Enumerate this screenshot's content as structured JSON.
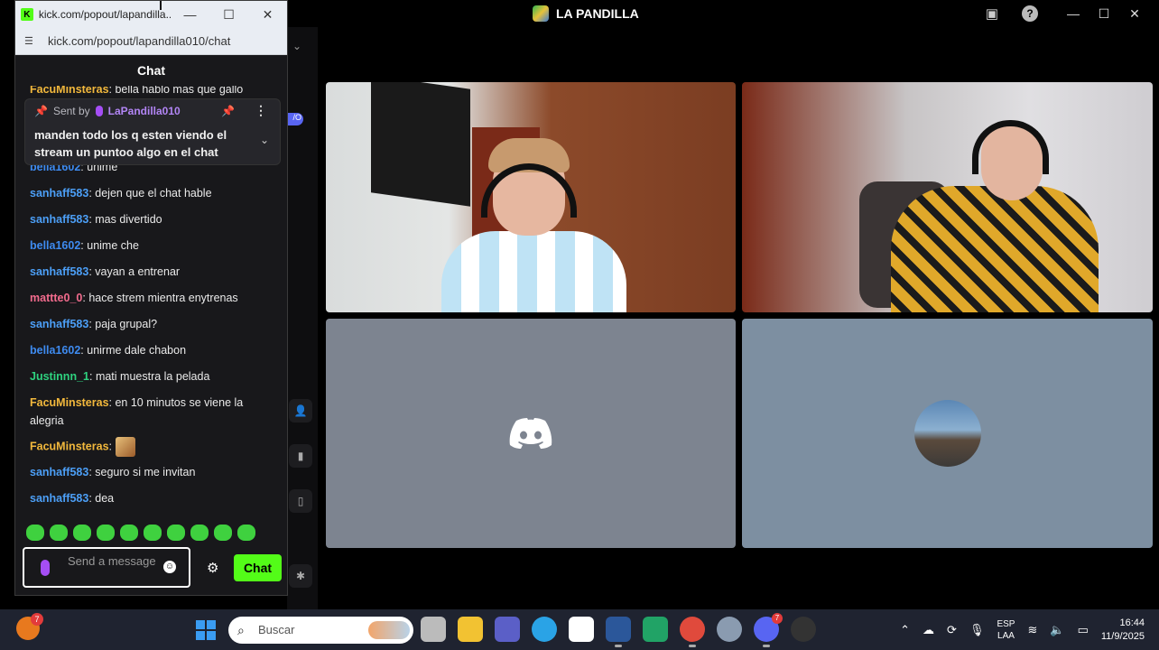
{
  "discord": {
    "server_title": "LA PANDILLA",
    "help_icon": "?",
    "window_controls": [
      "—",
      "☐",
      "✕"
    ],
    "pill_label": "/O"
  },
  "kick": {
    "window_title": "kick.com/popout/lapandilla...",
    "url": "kick.com/popout/lapandilla010/chat",
    "window_controls": [
      "—",
      "☐",
      "✕"
    ],
    "header": "Chat",
    "top_cut_message": {
      "user": "FacuMinsteras",
      "text": ": bella hablo mas que gallo"
    },
    "pinned": {
      "sent_by_label": "Sent by",
      "user": "LaPandilla010",
      "text": "manden todo los q esten viendo el stream un puntoo algo en el chat"
    },
    "messages": [
      {
        "user": "bella1602",
        "text": ": unime"
      },
      {
        "user": "sanhaff583",
        "text": ": dejen que el chat hable"
      },
      {
        "user": "sanhaff583",
        "text": ": mas divertido"
      },
      {
        "user": "bella1602",
        "text": ": unime che"
      },
      {
        "user": "sanhaff583",
        "text": ": vayan a entrenar"
      },
      {
        "user": "mattte0_0",
        "text": ": hace strem mientra enytrenas"
      },
      {
        "user": "sanhaff583",
        "text": ": paja grupal?"
      },
      {
        "user": "bella1602",
        "text": ": unirme dale chabon"
      },
      {
        "user": "Justinnn_1",
        "text": ": mati muestra la pelada"
      },
      {
        "user": "FacuMinsteras",
        "text": ": en 10 minutos se viene la alegria"
      },
      {
        "user": "FacuMinsteras",
        "text": ":"
      },
      {
        "user": "sanhaff583",
        "text": ": seguro si me invitan"
      },
      {
        "user": "sanhaff583",
        "text": ": dea"
      }
    ],
    "input_placeholder": "Send a message",
    "send_button": "Chat",
    "colors": {
      "brand": "#53fc18",
      "pin_badge": "#a54ef5"
    }
  },
  "taskbar": {
    "notif_count": "7",
    "search_placeholder": "Buscar",
    "discord_badge": "7",
    "lang_line1": "ESP",
    "lang_line2": "LAA",
    "time": "16:44",
    "date": "11/9/2025"
  }
}
